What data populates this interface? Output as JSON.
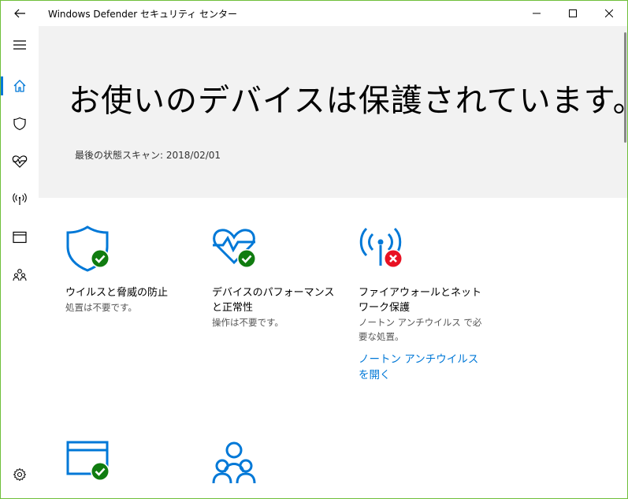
{
  "window": {
    "title": "Windows Defender セキュリティ センター",
    "minimize": "minimize",
    "maximize": "maximize",
    "close": "close"
  },
  "sidebar": {
    "items": [
      {
        "icon": "hamburger-menu-icon"
      },
      {
        "icon": "home-icon",
        "active": true
      },
      {
        "icon": "shield-icon"
      },
      {
        "icon": "heart-pulse-icon"
      },
      {
        "icon": "antenna-icon"
      },
      {
        "icon": "browser-window-icon"
      },
      {
        "icon": "family-icon"
      },
      {
        "icon": "gear-icon"
      }
    ]
  },
  "hero": {
    "title": "お使いのデバイスは保護されています。",
    "last_scan": "最後の状態スキャン: 2018/02/01"
  },
  "tiles": [
    {
      "title": "ウイルスと脅威の防止",
      "description": "処置は不要です。",
      "status": "ok",
      "icon": "shield-icon"
    },
    {
      "title": "デバイスのパフォーマンスと正常性",
      "description": "操作は不要です。",
      "status": "ok",
      "icon": "heart-pulse-icon"
    },
    {
      "title": "ファイアウォールとネットワーク保護",
      "description": "ノートン アンチウイルス で必要な処置。",
      "link": "ノートン アンチウイルス を開く",
      "status": "error",
      "icon": "antenna-icon"
    },
    {
      "title": "",
      "description": "",
      "status": "ok",
      "icon": "browser-window-icon"
    },
    {
      "title": "",
      "description": "",
      "status": "none",
      "icon": "family-icon"
    }
  ],
  "colors": {
    "accent": "#0078d7",
    "ok": "#107c10",
    "error": "#e81123",
    "hero_bg": "#f2f2f2"
  }
}
